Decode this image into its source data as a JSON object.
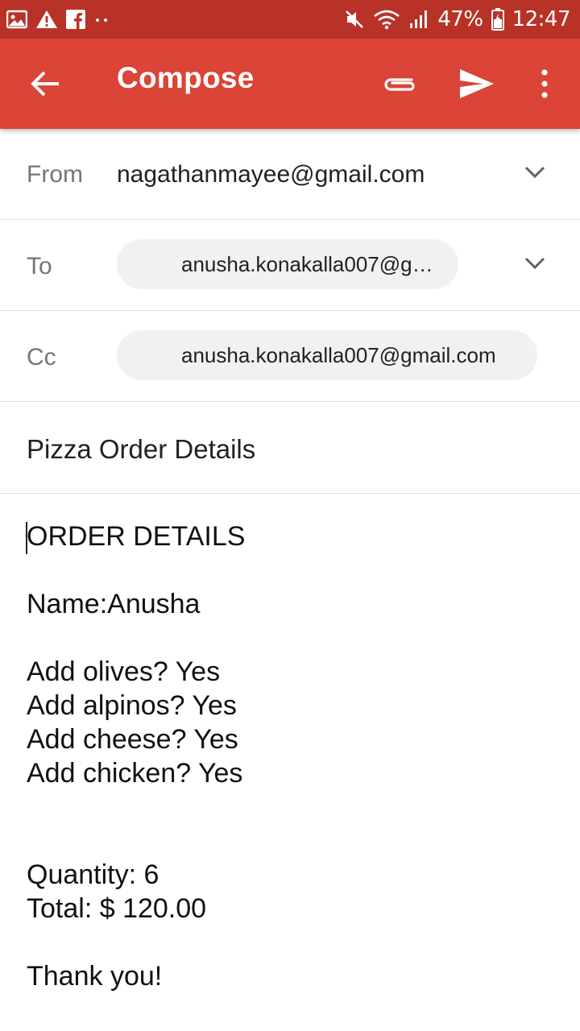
{
  "status_bar": {
    "battery": "47%",
    "time": "12:47",
    "icons": [
      "image-icon",
      "warning-icon",
      "facebook-icon",
      "more-dots-icon",
      "mute-icon",
      "wifi-icon",
      "signal-icon",
      "battery-icon"
    ]
  },
  "app_bar": {
    "title": "Compose",
    "icons": [
      "back-arrow-icon",
      "attachment-icon",
      "send-icon",
      "more-vert-icon"
    ]
  },
  "from": {
    "label": "From",
    "value": "nagathanmayee@gmail.com"
  },
  "to": {
    "label": "To",
    "chip": "anusha.konakalla007@g…"
  },
  "cc": {
    "label": "Cc",
    "chip": "anusha.konakalla007@gmail.com"
  },
  "subject": "Pizza Order Details",
  "body": {
    "heading": "ORDER DETAILS",
    "name": "Name:Anusha",
    "olives": "Add olives? Yes",
    "alpinos": "Add alpinos? Yes",
    "cheese": "Add cheese? Yes",
    "chicken": "Add chicken? Yes",
    "quantity": "Quantity: 6",
    "total": "Total: $ 120.00",
    "closing": "Thank you!"
  },
  "colors": {
    "status_bar": "#b83228",
    "app_bar": "#db4437"
  }
}
